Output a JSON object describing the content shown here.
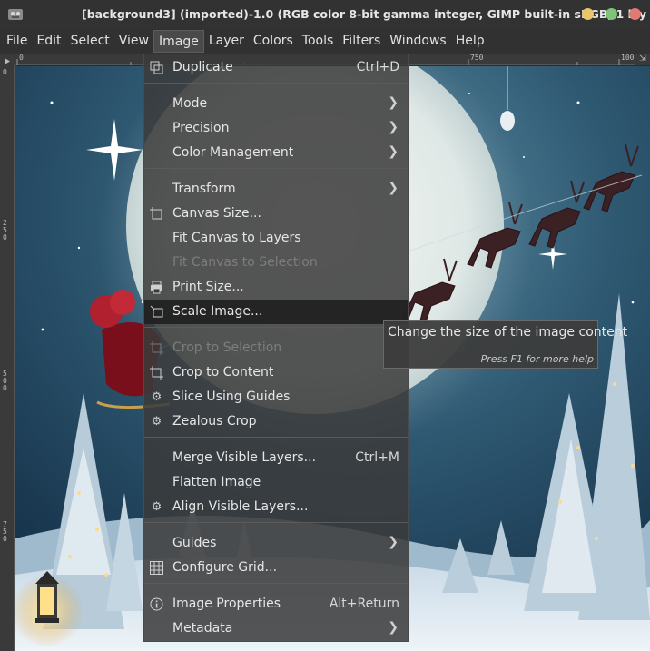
{
  "window": {
    "title": "[background3] (imported)-1.0 (RGB color 8-bit gamma integer, GIMP built-in sRGB, 1 lay",
    "app_icon": "gimp-icon",
    "controls": [
      {
        "name": "minimize-button",
        "color": "#e8c46a"
      },
      {
        "name": "maximize-button",
        "color": "#7fc27a"
      },
      {
        "name": "close-button",
        "color": "#e07a72"
      }
    ]
  },
  "menubar": {
    "items": [
      {
        "label": "File"
      },
      {
        "label": "Edit"
      },
      {
        "label": "Select"
      },
      {
        "label": "View"
      },
      {
        "label": "Image",
        "active": true
      },
      {
        "label": "Layer"
      },
      {
        "label": "Colors"
      },
      {
        "label": "Tools"
      },
      {
        "label": "Filters"
      },
      {
        "label": "Windows"
      },
      {
        "label": "Help"
      }
    ]
  },
  "rulers": {
    "top_labels": [
      "0",
      "750",
      "100"
    ],
    "left_labels": [
      "0",
      "250",
      "500",
      "750"
    ]
  },
  "image_menu": {
    "duplicate": {
      "label": "Duplicate",
      "shortcut": "Ctrl+D",
      "icon": "duplicate-icon"
    },
    "mode": {
      "label": "Mode"
    },
    "precision": {
      "label": "Precision"
    },
    "color_management": {
      "label": "Color Management"
    },
    "transform": {
      "label": "Transform"
    },
    "canvas_size": {
      "label": "Canvas Size...",
      "icon": "canvas-size-icon"
    },
    "fit_canvas_layers": {
      "label": "Fit Canvas to Layers"
    },
    "fit_canvas_selection": {
      "label": "Fit Canvas to Selection",
      "disabled": true
    },
    "print_size": {
      "label": "Print Size...",
      "icon": "printer-icon"
    },
    "scale_image": {
      "label": "Scale Image...",
      "icon": "scale-icon",
      "highlighted": true
    },
    "crop_selection": {
      "label": "Crop to Selection",
      "icon": "crop-icon",
      "disabled": true
    },
    "crop_content": {
      "label": "Crop to Content",
      "icon": "crop-icon"
    },
    "slice_guides": {
      "label": "Slice Using Guides",
      "icon": "gear-icon"
    },
    "zealous_crop": {
      "label": "Zealous Crop",
      "icon": "gear-icon"
    },
    "merge_visible": {
      "label": "Merge Visible Layers...",
      "shortcut": "Ctrl+M"
    },
    "flatten": {
      "label": "Flatten Image"
    },
    "align_visible": {
      "label": "Align Visible Layers...",
      "icon": "gear-icon"
    },
    "guides": {
      "label": "Guides"
    },
    "configure_grid": {
      "label": "Configure Grid...",
      "icon": "grid-icon"
    },
    "image_properties": {
      "label": "Image Properties",
      "shortcut": "Alt+Return",
      "icon": "info-icon"
    },
    "metadata": {
      "label": "Metadata"
    }
  },
  "tooltip": {
    "text": "Change the size of the image content",
    "help": "Press F1 for more help"
  }
}
